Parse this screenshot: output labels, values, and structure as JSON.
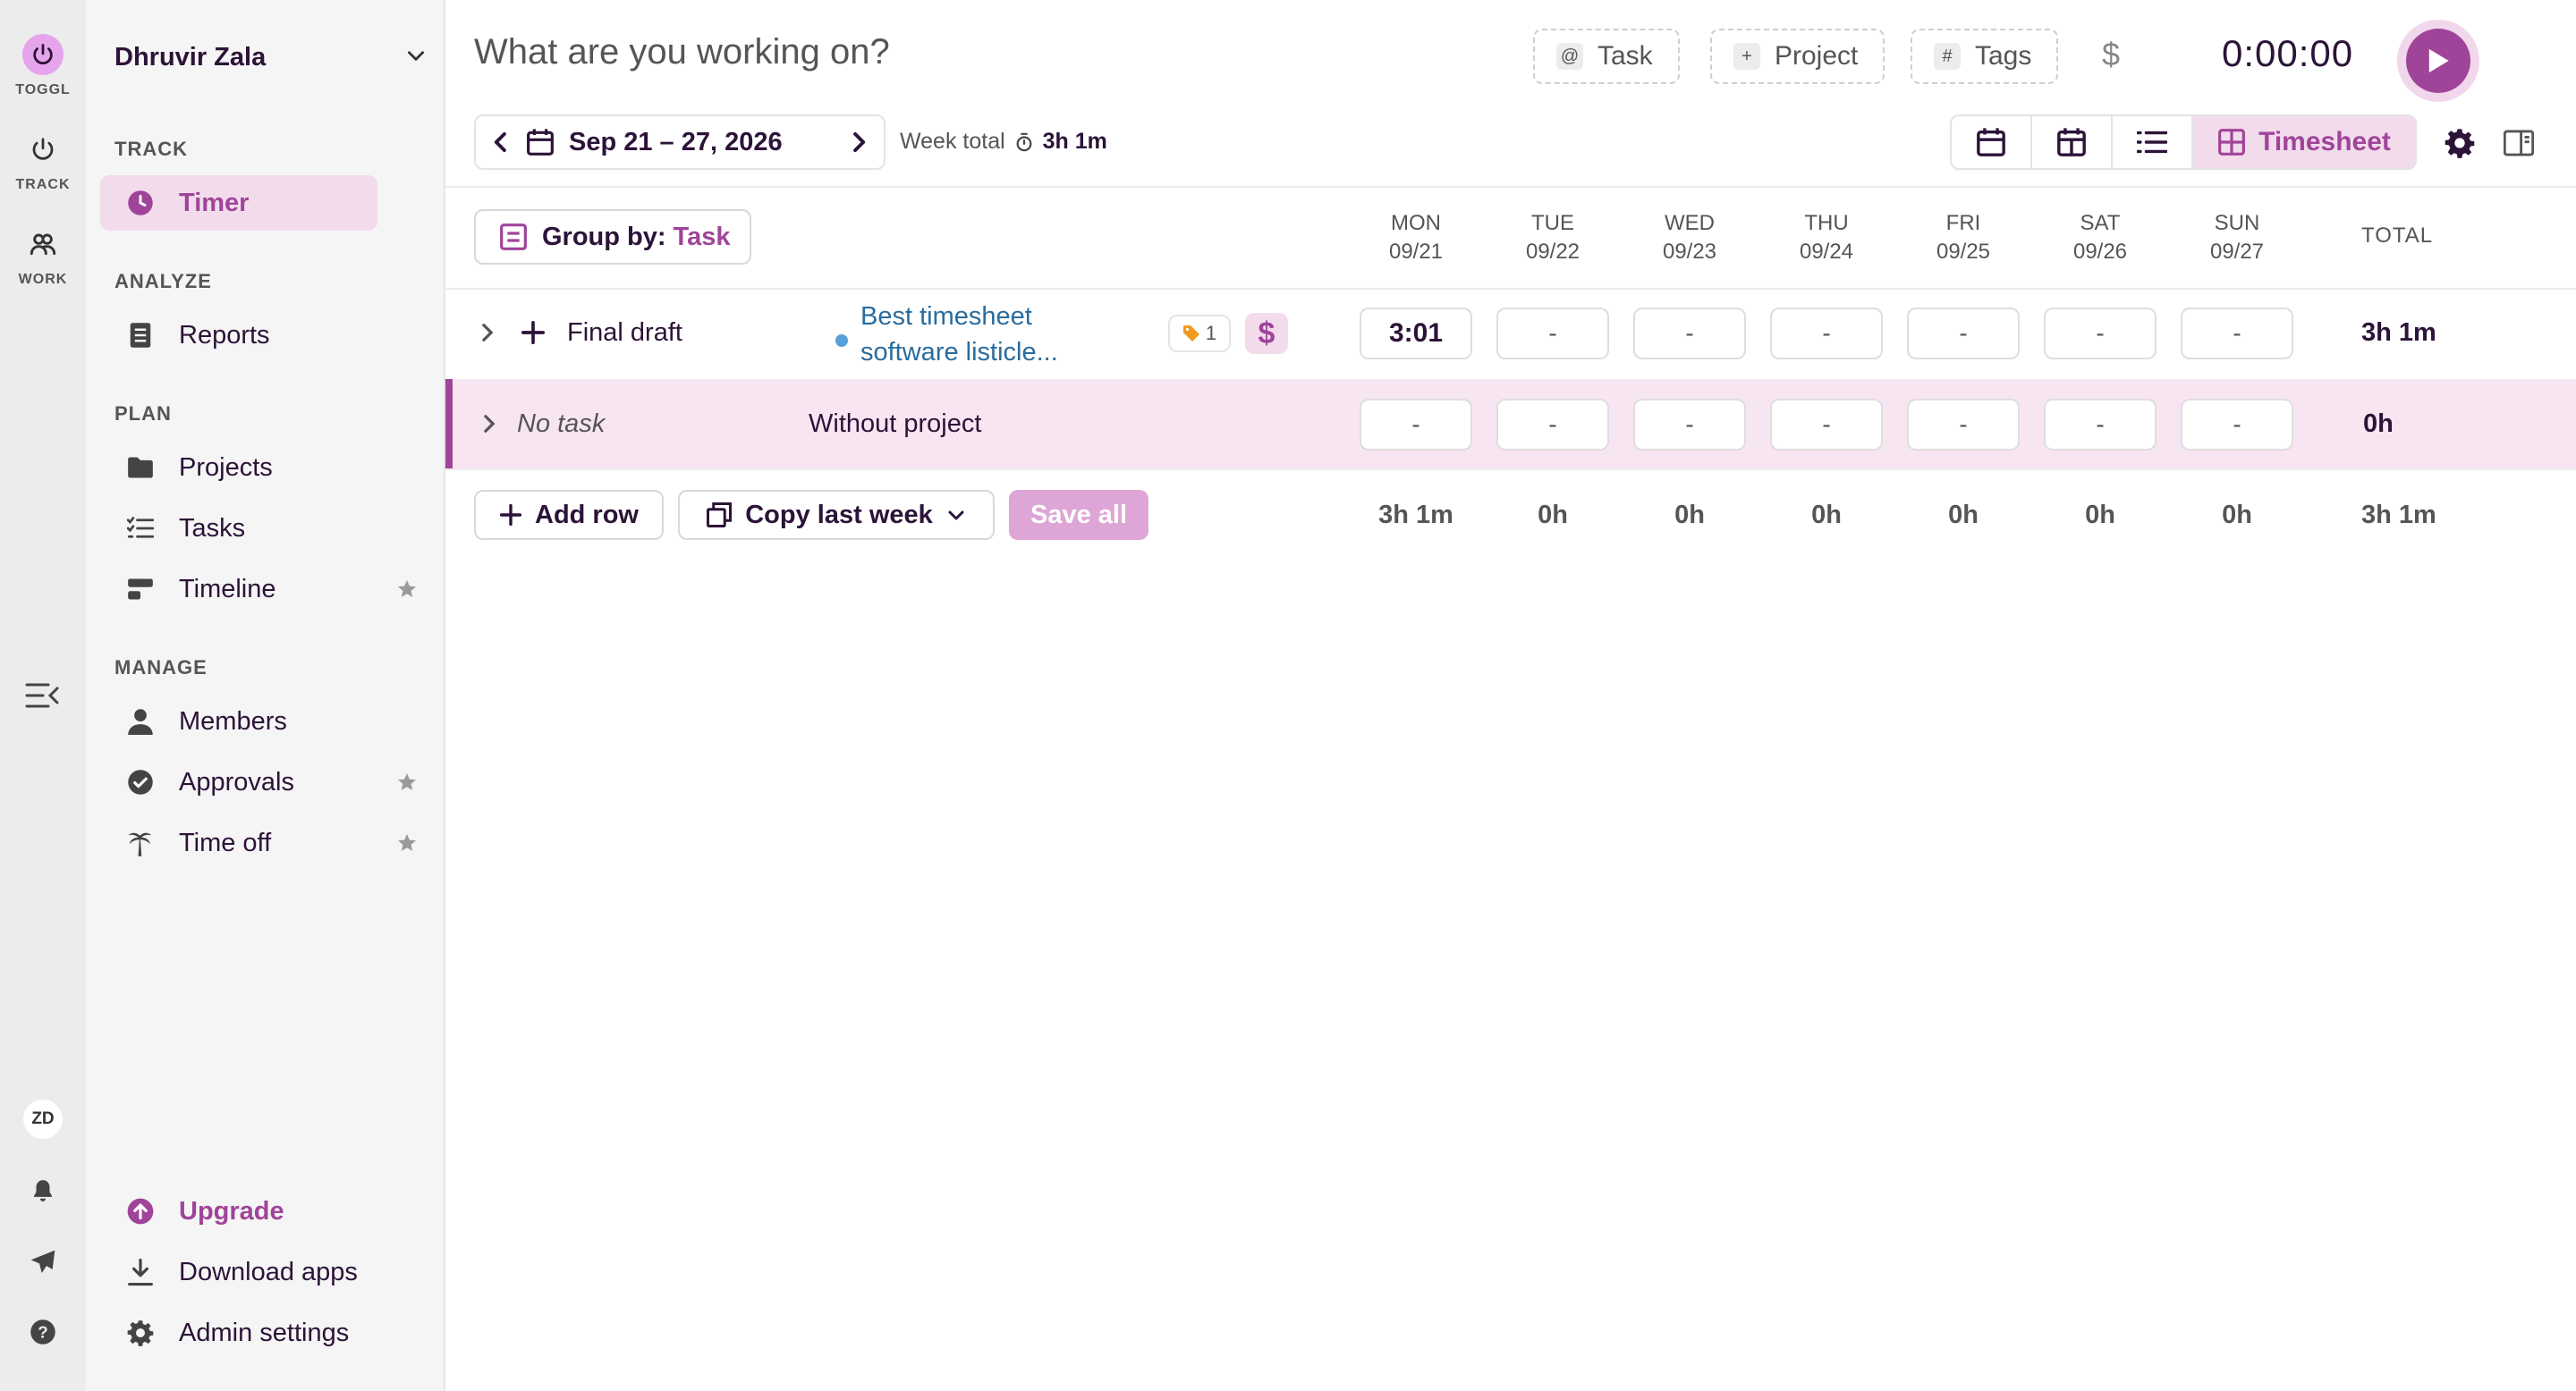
{
  "rail": {
    "items": [
      {
        "label": "TOGGL",
        "icon": "power-icon"
      },
      {
        "label": "TRACK",
        "icon": "power-icon"
      },
      {
        "label": "WORK",
        "icon": "people-icon"
      }
    ],
    "avatar": "ZD"
  },
  "sidebar": {
    "workspace": "Dhruvir Zala",
    "sections": {
      "track": "TRACK",
      "analyze": "ANALYZE",
      "plan": "PLAN",
      "manage": "MANAGE"
    },
    "items": {
      "timer": "Timer",
      "reports": "Reports",
      "projects": "Projects",
      "tasks": "Tasks",
      "timeline": "Timeline",
      "members": "Members",
      "approvals": "Approvals",
      "timeoff": "Time off"
    },
    "footer": {
      "upgrade": "Upgrade",
      "download": "Download apps",
      "admin": "Admin settings"
    }
  },
  "header": {
    "description_placeholder": "What are you working on?",
    "task_chip": "Task",
    "project_chip": "Project",
    "tags_chip": "Tags",
    "billable_symbol": "$",
    "timer": "0:00:00"
  },
  "toolbar": {
    "date_range": "Sep 21 – 27, 2026",
    "week_total_label": "Week total",
    "week_total_value": "3h 1m",
    "timesheet_label": "Timesheet"
  },
  "grid": {
    "group_by_label": "Group by:",
    "group_by_value": "Task",
    "days": [
      {
        "name": "MON",
        "date": "09/21"
      },
      {
        "name": "TUE",
        "date": "09/22"
      },
      {
        "name": "WED",
        "date": "09/23"
      },
      {
        "name": "THU",
        "date": "09/24"
      },
      {
        "name": "FRI",
        "date": "09/25"
      },
      {
        "name": "SAT",
        "date": "09/26"
      },
      {
        "name": "SUN",
        "date": "09/27"
      }
    ],
    "total_label": "TOTAL",
    "rows": [
      {
        "task": "Final draft",
        "project": "Best timesheet software listicle...",
        "tag_count": "1",
        "billable": "$",
        "cells": [
          "3:01",
          "-",
          "-",
          "-",
          "-",
          "-",
          "-"
        ],
        "total": "3h 1m"
      },
      {
        "task": "No task",
        "project": "Without project",
        "cells": [
          "-",
          "-",
          "-",
          "-",
          "-",
          "-",
          "-"
        ],
        "total": "0h"
      }
    ],
    "actions": {
      "add_row": "Add row",
      "copy_last_week": "Copy last week",
      "save_all": "Save all"
    },
    "day_totals": [
      "3h 1m",
      "0h",
      "0h",
      "0h",
      "0h",
      "0h",
      "0h"
    ],
    "grand_total": "3h 1m"
  },
  "colors": {
    "accent": "#a0449a",
    "accent_light": "#f2dcec",
    "project_blue": "#2a6c9e"
  }
}
